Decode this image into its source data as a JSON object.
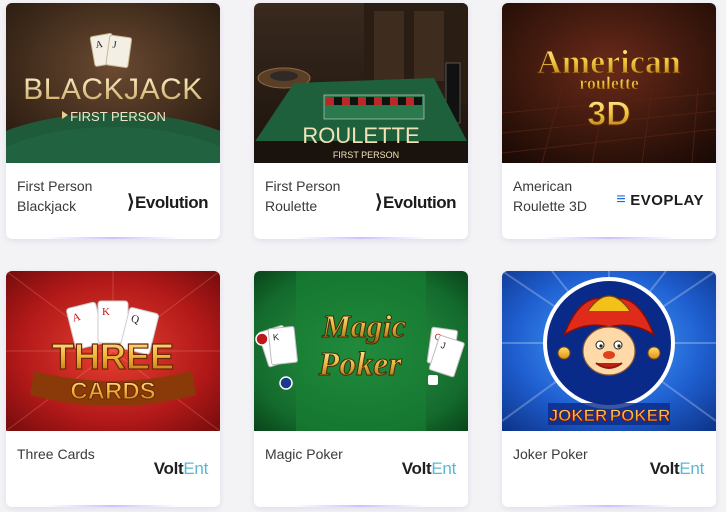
{
  "games": [
    {
      "name": "First Person Blackjack",
      "thumb_title": "BLACKJACK",
      "thumb_subtitle": "FIRST PERSON",
      "provider": "Evolution",
      "provider_mark": "⟩"
    },
    {
      "name": "First Person Roulette",
      "thumb_title": "ROULETTE",
      "thumb_subtitle": "FIRST PERSON",
      "provider": "Evolution",
      "provider_mark": "⟩"
    },
    {
      "name": "American Roulette 3D",
      "thumb_title_1": "American",
      "thumb_title_2": "roulette",
      "thumb_title_3": "3D",
      "provider": "EVOPLAY",
      "provider_mark": "≡"
    },
    {
      "name": "Three Cards",
      "thumb_title_1": "THREE",
      "thumb_title_2": "CARDS",
      "provider": "Volt",
      "provider_suffix": "Ent"
    },
    {
      "name": "Magic Poker",
      "thumb_title_1": "Magic",
      "thumb_title_2": "Poker",
      "provider": "Volt",
      "provider_suffix": "Ent"
    },
    {
      "name": "Joker Poker",
      "thumb_title_1": "JOKER",
      "thumb_title_2": "POKER",
      "provider": "Volt",
      "provider_suffix": "Ent"
    }
  ],
  "colors": {
    "card_bg": "#ffffff",
    "page_bg": "#f3f3f6",
    "text": "#3a3a3a",
    "evoplay_blue": "#1d6fd8",
    "volt_ent": "#5ab8d6"
  }
}
